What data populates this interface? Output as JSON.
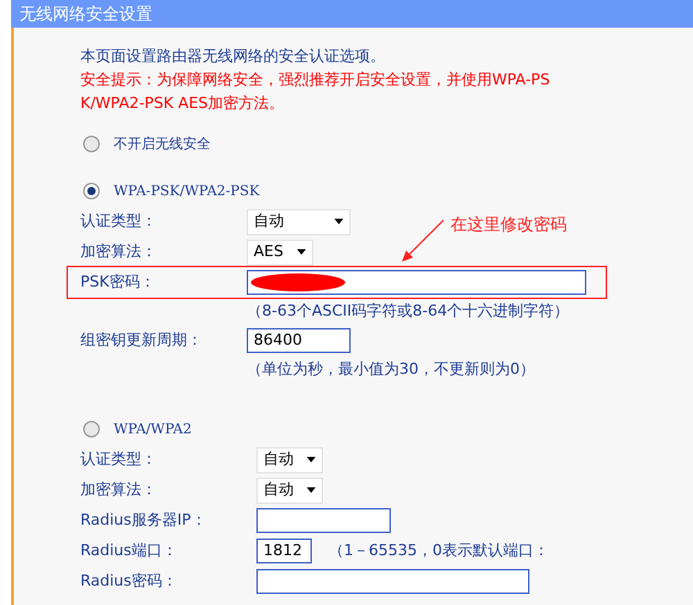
{
  "window": {
    "title": "无线网络安全设置"
  },
  "intro": "本页面设置路由器无线网络的安全认证选项。",
  "warning": "安全提示：为保障网络安全，强烈推荐开启安全设置，并使用WPA-PSK/WPA2-PSK AES加密方法。",
  "modes": [
    {
      "label": "不开启无线安全",
      "selected": false
    },
    {
      "label": "WPA-PSK/WPA2-PSK",
      "selected": true,
      "fields": [
        {
          "kind": "select",
          "label": "认证类型：",
          "value": "自动"
        },
        {
          "kind": "select",
          "label": "加密算法：",
          "value": "AES"
        },
        {
          "kind": "text",
          "label": "PSK密码：",
          "redacted": true,
          "highlighted": true,
          "hint": "（8-63个ASCII码字符或8-64个十六进制字符）"
        },
        {
          "kind": "text",
          "label": "组密钥更新周期：",
          "value": "86400",
          "hint": "（单位为秒，最小值为30，不更新则为0）"
        }
      ]
    },
    {
      "label": "WPA/WPA2",
      "selected": false,
      "fields": [
        {
          "kind": "select",
          "label": "认证类型：",
          "value": "自动"
        },
        {
          "kind": "select",
          "label": "加密算法：",
          "value": "自动"
        },
        {
          "kind": "text",
          "label": "Radius服务器IP："
        },
        {
          "kind": "text",
          "label": "Radius端口：",
          "value": "1812",
          "note": "（1－65535，0表示默认端口："
        },
        {
          "kind": "text",
          "label": "Radius密码："
        }
      ]
    }
  ],
  "annotation": {
    "text": "在这里修改密码"
  }
}
